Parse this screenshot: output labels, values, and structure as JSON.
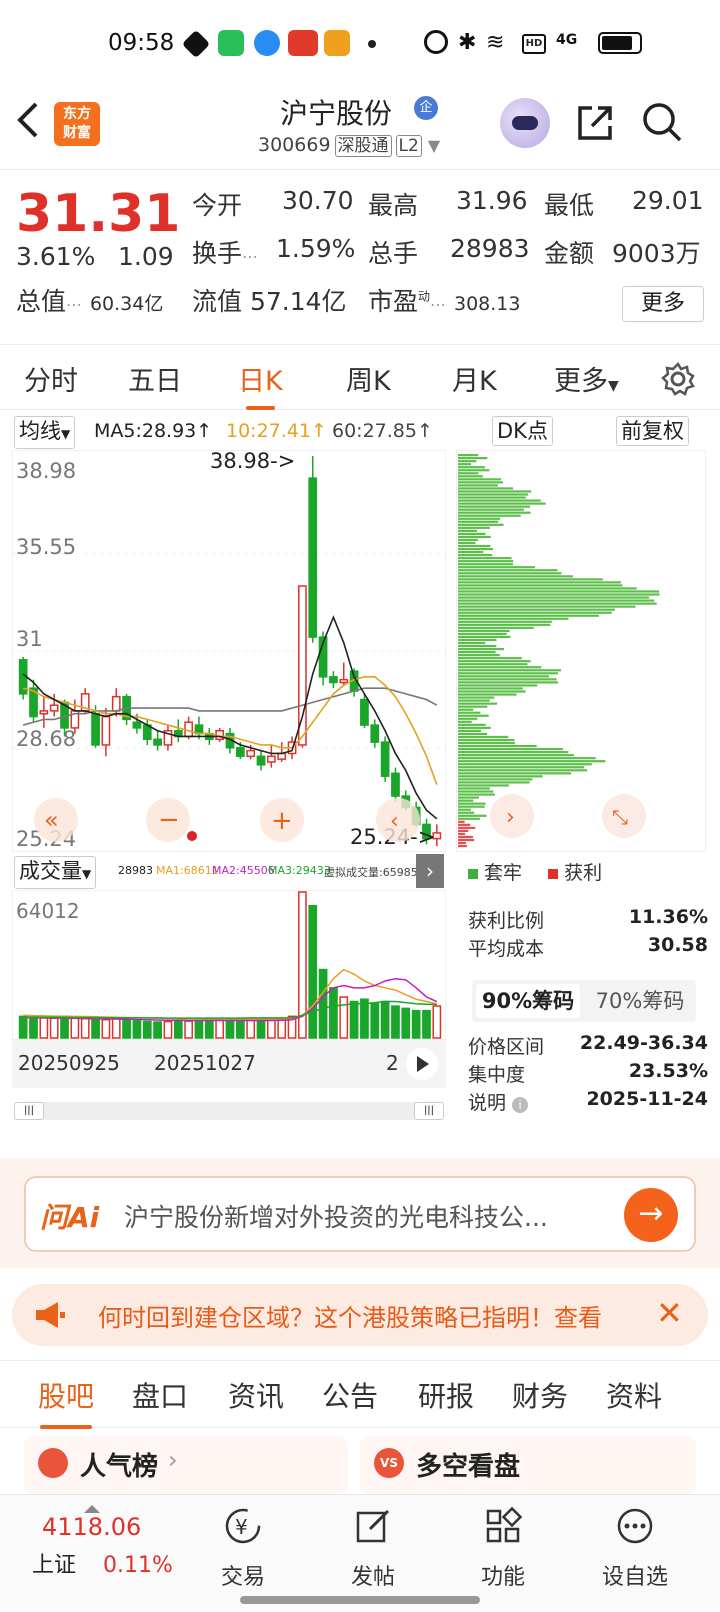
{
  "status_bar": {
    "time": "09:58",
    "battery_icon": "battery-icon",
    "signal": "4G"
  },
  "header": {
    "logo_text_line1": "东方",
    "logo_text_line2": "财富",
    "title": "沪宁股份",
    "corp_badge": "企",
    "code": "300669",
    "tag1": "深股通",
    "tag2": "L2"
  },
  "quote": {
    "price": "31.31",
    "change_pct": "3.61%",
    "change": "1.09",
    "open_label": "今开",
    "open": "30.70",
    "high_label": "最高",
    "high": "31.96",
    "low_label": "最低",
    "low": "29.01",
    "turnover_label": "换手",
    "turnover": "1.59%",
    "volume_label": "总手",
    "volume": "28983",
    "amount_label": "金额",
    "amount": "9003万",
    "mktcap_label": "总值",
    "mktcap": "60.34亿",
    "float_label": "流值",
    "float": "57.14亿",
    "pe_label": "市盈",
    "pe_sup": "动",
    "pe": "308.13",
    "more": "更多"
  },
  "ktabs": [
    "分时",
    "五日",
    "日K",
    "周K",
    "月K",
    "更多"
  ],
  "ktab_active": 2,
  "ma_legend": {
    "selector": "均线",
    "ma5": "MA5:28.93",
    "ma10": "10:27.41",
    "ma60": "60:27.85",
    "dk": "DK点",
    "fq": "前复权"
  },
  "kchart": {
    "y_labels": [
      "38.98",
      "35.55",
      "31",
      "28.68",
      "25.24"
    ],
    "max_label": "38.98->",
    "min_label": "25.24->"
  },
  "volume_legend": {
    "selector": "成交量",
    "vol": "28983",
    "ma1": "MA1:68611",
    "ma2": "MA2:45506",
    "ma3": "MA3:29433",
    "virtual": "虚拟成交量:65985",
    "ymax": "64012",
    "dates": [
      "20250925",
      "20251027",
      "2"
    ]
  },
  "chip_panel": {
    "legend_trapped": "套牢",
    "legend_profit": "获利",
    "rows": [
      {
        "label": "获利比例",
        "value": "11.36%"
      },
      {
        "label": "平均成本",
        "value": "30.58"
      }
    ],
    "btn90": "90%筹码",
    "btn70": "70%筹码",
    "rows2": [
      {
        "label": "价格区间",
        "value": "22.49-36.34"
      },
      {
        "label": "集中度",
        "value": "23.53%"
      },
      {
        "label": "说明",
        "value": "2025-11-24"
      }
    ]
  },
  "ai": {
    "logo": "问Ai",
    "text": "沪宁股份新增对外投资的光电科技公..."
  },
  "notice": {
    "text": "何时回到建仓区域？这个港股策略已指明！查看"
  },
  "btabs": [
    "股吧",
    "盘口",
    "资讯",
    "公告",
    "研报",
    "财务",
    "资料"
  ],
  "btab_active": 0,
  "cards": {
    "left": "人气榜",
    "right": "多空看盘"
  },
  "bottom_nav": {
    "index_value": "4118.06",
    "index_name": "上证",
    "index_pct": "0.11%",
    "items": [
      "交易",
      "发帖",
      "功能",
      "设自选"
    ]
  },
  "chart_data": {
    "type": "candlestick",
    "ylim": [
      25.24,
      38.98
    ],
    "colors": {
      "up": "#e0302a",
      "down": "#1aa62a",
      "ma5": "#222222",
      "ma10": "#e8a020",
      "ma60": "#777777"
    },
    "candles": [
      {
        "o": 31.8,
        "c": 30.6,
        "h": 31.9,
        "l": 30.4
      },
      {
        "o": 30.8,
        "c": 29.8,
        "h": 31.1,
        "l": 29.6
      },
      {
        "o": 29.9,
        "c": 30.0,
        "h": 30.5,
        "l": 29.4
      },
      {
        "o": 30.0,
        "c": 30.2,
        "h": 30.6,
        "l": 29.8
      },
      {
        "o": 30.3,
        "c": 29.4,
        "h": 30.4,
        "l": 29.1
      },
      {
        "o": 29.4,
        "c": 30.0,
        "h": 30.4,
        "l": 29.2
      },
      {
        "o": 30.0,
        "c": 30.6,
        "h": 30.8,
        "l": 29.9
      },
      {
        "o": 29.9,
        "c": 28.8,
        "h": 30.2,
        "l": 28.7
      },
      {
        "o": 28.8,
        "c": 29.8,
        "h": 30.1,
        "l": 28.4
      },
      {
        "o": 30.0,
        "c": 30.5,
        "h": 30.8,
        "l": 29.8
      },
      {
        "o": 30.5,
        "c": 29.7,
        "h": 30.6,
        "l": 29.5
      },
      {
        "o": 29.6,
        "c": 29.4,
        "h": 29.9,
        "l": 29.2
      },
      {
        "o": 29.5,
        "c": 29.0,
        "h": 29.7,
        "l": 28.8
      },
      {
        "o": 29.0,
        "c": 28.8,
        "h": 29.3,
        "l": 28.6
      },
      {
        "o": 28.8,
        "c": 29.3,
        "h": 29.5,
        "l": 28.6
      },
      {
        "o": 29.3,
        "c": 29.1,
        "h": 29.7,
        "l": 28.9
      },
      {
        "o": 29.1,
        "c": 29.6,
        "h": 29.8,
        "l": 29.0
      },
      {
        "o": 29.5,
        "c": 29.2,
        "h": 29.8,
        "l": 29.0
      },
      {
        "o": 29.2,
        "c": 29.0,
        "h": 29.4,
        "l": 28.8
      },
      {
        "o": 29.0,
        "c": 29.3,
        "h": 29.4,
        "l": 28.9
      },
      {
        "o": 29.2,
        "c": 28.7,
        "h": 29.4,
        "l": 28.5
      },
      {
        "o": 28.7,
        "c": 28.4,
        "h": 28.9,
        "l": 28.3
      },
      {
        "o": 28.4,
        "c": 28.6,
        "h": 28.8,
        "l": 28.3
      },
      {
        "o": 28.4,
        "c": 28.1,
        "h": 28.6,
        "l": 27.9
      },
      {
        "o": 28.2,
        "c": 28.4,
        "h": 28.8,
        "l": 28.0
      },
      {
        "o": 28.3,
        "c": 28.5,
        "h": 28.9,
        "l": 28.2
      },
      {
        "o": 28.5,
        "c": 28.9,
        "h": 29.1,
        "l": 28.3
      },
      {
        "o": 28.8,
        "c": 34.4,
        "h": 34.4,
        "l": 28.7
      },
      {
        "o": 38.2,
        "c": 32.6,
        "h": 38.98,
        "l": 32.4
      },
      {
        "o": 32.6,
        "c": 31.2,
        "h": 32.8,
        "l": 30.9
      },
      {
        "o": 31.2,
        "c": 31.0,
        "h": 31.4,
        "l": 30.8
      },
      {
        "o": 31.0,
        "c": 31.1,
        "h": 31.7,
        "l": 30.9
      },
      {
        "o": 31.4,
        "c": 30.7,
        "h": 31.5,
        "l": 30.5
      },
      {
        "o": 30.4,
        "c": 29.5,
        "h": 30.6,
        "l": 29.4
      },
      {
        "o": 29.5,
        "c": 28.9,
        "h": 29.7,
        "l": 28.7
      },
      {
        "o": 28.9,
        "c": 27.7,
        "h": 29.1,
        "l": 27.5
      },
      {
        "o": 27.8,
        "c": 27.0,
        "h": 28.0,
        "l": 26.8
      },
      {
        "o": 27.0,
        "c": 26.6,
        "h": 27.2,
        "l": 26.5
      },
      {
        "o": 26.6,
        "c": 26.0,
        "h": 26.8,
        "l": 25.9
      },
      {
        "o": 26.0,
        "c": 25.5,
        "h": 26.2,
        "l": 25.3
      },
      {
        "o": 25.5,
        "c": 25.7,
        "h": 26.0,
        "l": 25.24
      }
    ],
    "ma5": [
      31.3,
      31.0,
      30.6,
      30.4,
      30.2,
      30.0,
      30.0,
      29.9,
      29.8,
      29.9,
      29.9,
      29.7,
      29.5,
      29.3,
      29.2,
      29.1,
      29.1,
      29.1,
      29.1,
      29.1,
      29.0,
      28.8,
      28.7,
      28.6,
      28.5,
      28.5,
      28.6,
      29.8,
      31.3,
      32.4,
      33.3,
      32.4,
      31.2,
      30.6,
      30.0,
      29.3,
      28.5,
      27.9,
      27.1,
      26.5,
      26.2
    ],
    "ma10": [
      30.8,
      30.7,
      30.5,
      30.4,
      30.3,
      30.2,
      30.1,
      30.0,
      29.9,
      29.9,
      29.8,
      29.8,
      29.7,
      29.6,
      29.5,
      29.4,
      29.3,
      29.2,
      29.2,
      29.1,
      29.1,
      29.0,
      28.9,
      28.8,
      28.8,
      28.7,
      28.7,
      29.1,
      29.6,
      30.1,
      30.6,
      30.9,
      31.1,
      31.2,
      31.2,
      30.9,
      30.5,
      29.9,
      29.2,
      28.4,
      27.4
    ],
    "ma60": [
      29.5,
      29.6,
      29.7,
      29.7,
      29.8,
      29.9,
      29.9,
      30.0,
      30.0,
      30.0,
      30.1,
      30.1,
      30.1,
      30.1,
      30.1,
      30.1,
      30.1,
      30.0,
      30.0,
      30.0,
      30.0,
      30.0,
      30.0,
      30.0,
      30.0,
      30.0,
      30.1,
      30.2,
      30.3,
      30.4,
      30.5,
      30.6,
      30.7,
      30.8,
      30.8,
      30.8,
      30.7,
      30.6,
      30.5,
      30.4,
      30.2
    ],
    "volume": {
      "ymax": 64012,
      "values": [
        9500,
        9000,
        8800,
        8700,
        9500,
        9000,
        8500,
        8300,
        8000,
        8500,
        7800,
        7500,
        7200,
        7000,
        7200,
        7400,
        7400,
        7600,
        7800,
        8000,
        7900,
        7700,
        7700,
        7800,
        8000,
        8200,
        9500,
        64012,
        58000,
        30000,
        22000,
        18000,
        16000,
        17000,
        15000,
        16000,
        14000,
        13000,
        12000,
        12000,
        14000
      ],
      "ma1": [
        10000,
        9800,
        9700,
        9600,
        9600,
        9500,
        9400,
        9300,
        9200,
        9100,
        9000,
        8900,
        8800,
        8700,
        8600,
        8500,
        8400,
        8400,
        8300,
        8300,
        8300,
        8200,
        8200,
        8200,
        8200,
        8200,
        8300,
        10000,
        14000,
        20000,
        26000,
        30000,
        28000,
        25000,
        23000,
        22000,
        21000,
        19000,
        17000,
        16000,
        15000
      ],
      "ma2": [
        9000,
        8900,
        8800,
        8700,
        8700,
        8600,
        8500,
        8400,
        8400,
        8300,
        8200,
        8100,
        8000,
        7900,
        7800,
        7800,
        7700,
        7700,
        7700,
        7700,
        7700,
        7700,
        7700,
        7700,
        7700,
        7800,
        8000,
        9500,
        13000,
        18000,
        22000,
        23000,
        22000,
        22000,
        23000,
        25000,
        26000,
        25500,
        22000,
        18000,
        16000
      ],
      "ma3": [
        9200,
        9200,
        9100,
        9100,
        9100,
        9000,
        9000,
        9000,
        8900,
        8900,
        8900,
        8800,
        8800,
        8800,
        8700,
        8700,
        8700,
        8700,
        8700,
        8700,
        8700,
        8700,
        8800,
        8800,
        8800,
        8800,
        8900,
        10000,
        11500,
        13000,
        14000,
        14500,
        15000,
        15000,
        15500,
        16000,
        16000,
        15500,
        15000,
        14800,
        14700
      ]
    }
  }
}
